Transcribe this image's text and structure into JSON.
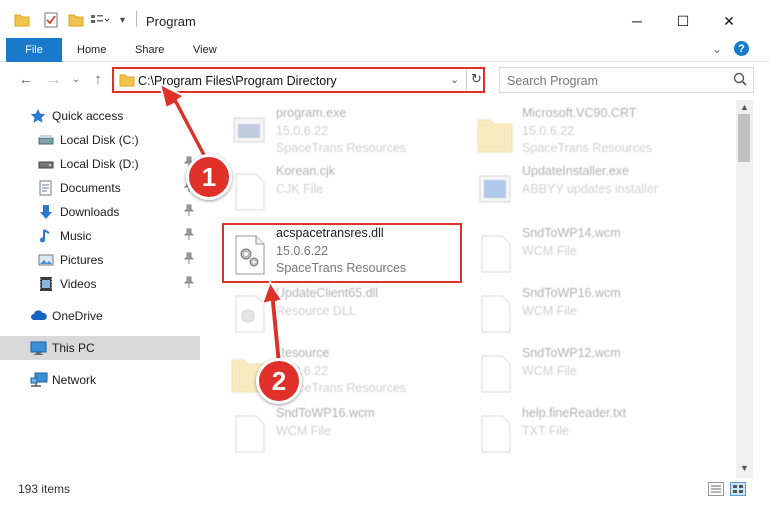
{
  "window": {
    "title": "Program",
    "minimize_glyph": "─",
    "maximize_glyph": "☐",
    "close_glyph": "✕"
  },
  "ribbon": {
    "tabs": [
      "File",
      "Home",
      "Share",
      "View"
    ],
    "expand_glyph": "⌄",
    "help_glyph": "?"
  },
  "nav": {
    "back_glyph": "←",
    "forward_glyph": "→",
    "recent_glyph": "⌄",
    "up_glyph": "↑"
  },
  "address": {
    "path": "C:\\Program Files\\Program Directory",
    "dropdown_glyph": "⌄",
    "refresh_glyph": "↻"
  },
  "search": {
    "placeholder": "Search Program"
  },
  "sidebar": {
    "items": [
      {
        "label": "Quick access",
        "icon": "star-icon"
      },
      {
        "label": "Local Disk (C:)",
        "icon": "drive-icon"
      },
      {
        "label": "Local Disk (D:)",
        "icon": "drive-icon"
      },
      {
        "label": "Documents",
        "icon": "documents-icon"
      },
      {
        "label": "Downloads",
        "icon": "download-icon"
      },
      {
        "label": "Music",
        "icon": "music-icon"
      },
      {
        "label": "Pictures",
        "icon": "pictures-icon"
      },
      {
        "label": "Videos",
        "icon": "videos-icon"
      },
      {
        "label": "OneDrive",
        "icon": "cloud-icon"
      },
      {
        "label": "This PC",
        "icon": "pc-icon"
      },
      {
        "label": "Network",
        "icon": "network-icon"
      }
    ],
    "pin_glyph": "📌"
  },
  "files": [
    {
      "name": "program.exe",
      "line2": "15.0.6.22",
      "line3": "SpaceTrans Resources"
    },
    {
      "name": "Microsoft.VC90.CRT",
      "line2": "15.0.6.22",
      "line3": "SpaceTrans Resources"
    },
    {
      "name": "Korean.cjk",
      "line2": "CJK File",
      "line3": ""
    },
    {
      "name": "UpdateInstaller.exe",
      "line2": "ABBYY updates installer",
      "line3": ""
    },
    {
      "name": "acspacetransres.dll",
      "line2": "15.0.6.22",
      "line3": "SpaceTrans Resources"
    },
    {
      "name": "SndToWP14.wcm",
      "line2": "WCM File",
      "line3": ""
    },
    {
      "name": "UpdateClient65.dll",
      "line2": "Resource DLL",
      "line3": ""
    },
    {
      "name": "SndToWP16.wcm",
      "line2": "WCM File",
      "line3": ""
    },
    {
      "name": "Resource",
      "line2": "15.0.6.22",
      "line3": "SpaceTrans Resources"
    },
    {
      "name": "SndToWP12.wcm",
      "line2": "WCM File",
      "line3": ""
    },
    {
      "name": "SndToWP16.wcm",
      "line2": "WCM File",
      "line3": ""
    },
    {
      "name": "help.fineReader.txt",
      "line2": "TXT File",
      "line3": ""
    }
  ],
  "status": {
    "count": "193 items"
  },
  "annotations": {
    "step1": "1",
    "step2": "2"
  },
  "colors": {
    "accent": "#1979ca",
    "highlight": "#e0302a"
  }
}
